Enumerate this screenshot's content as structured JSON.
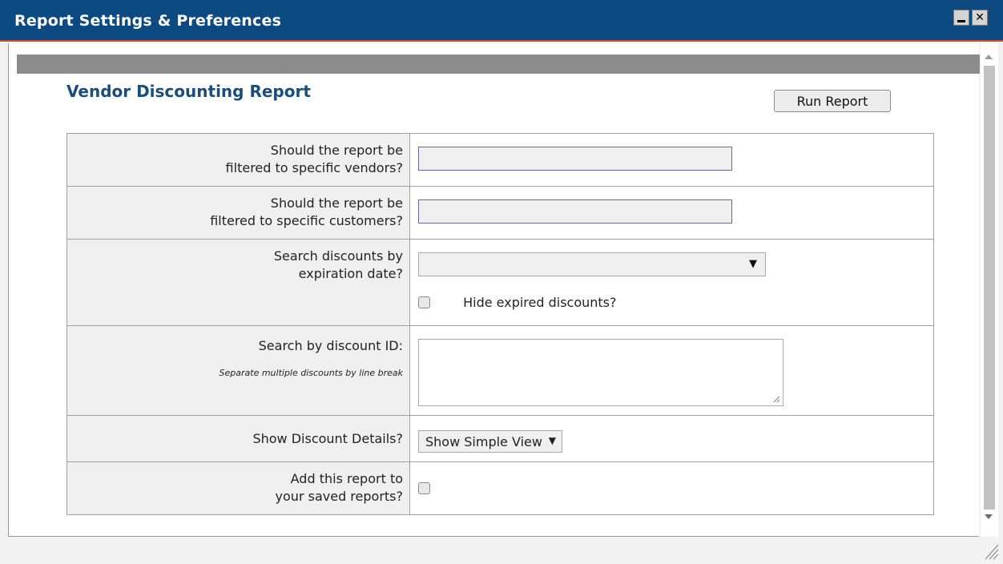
{
  "window": {
    "title": "Report Settings & Preferences",
    "minimize_label": "_",
    "close_label": "✕"
  },
  "report": {
    "title": "Vendor Discounting Report",
    "run_button": "Run Report"
  },
  "form": {
    "vendors": {
      "label_line1": "Should the report be",
      "label_line2": "filtered to specific vendors?",
      "value": ""
    },
    "customers": {
      "label_line1": "Should the report be",
      "label_line2": "filtered to specific customers?",
      "value": ""
    },
    "expiration": {
      "label_line1": "Search discounts by",
      "label_line2": "expiration date?",
      "selected": "",
      "hide_expired_label": "Hide expired discounts?",
      "hide_expired_checked": false
    },
    "discount_id": {
      "label": "Search by discount ID:",
      "note": "Separate multiple discounts by line break",
      "value": ""
    },
    "details": {
      "label": "Show Discount Details?",
      "selected": "Show Simple View"
    },
    "save": {
      "label_line1": "Add this report to",
      "label_line2": "your saved reports?",
      "checked": false
    }
  },
  "icons": {
    "dropdown_arrow": "▼"
  },
  "colors": {
    "titlebar": "#0e4a82",
    "title_accent": "#1a4d7a"
  }
}
